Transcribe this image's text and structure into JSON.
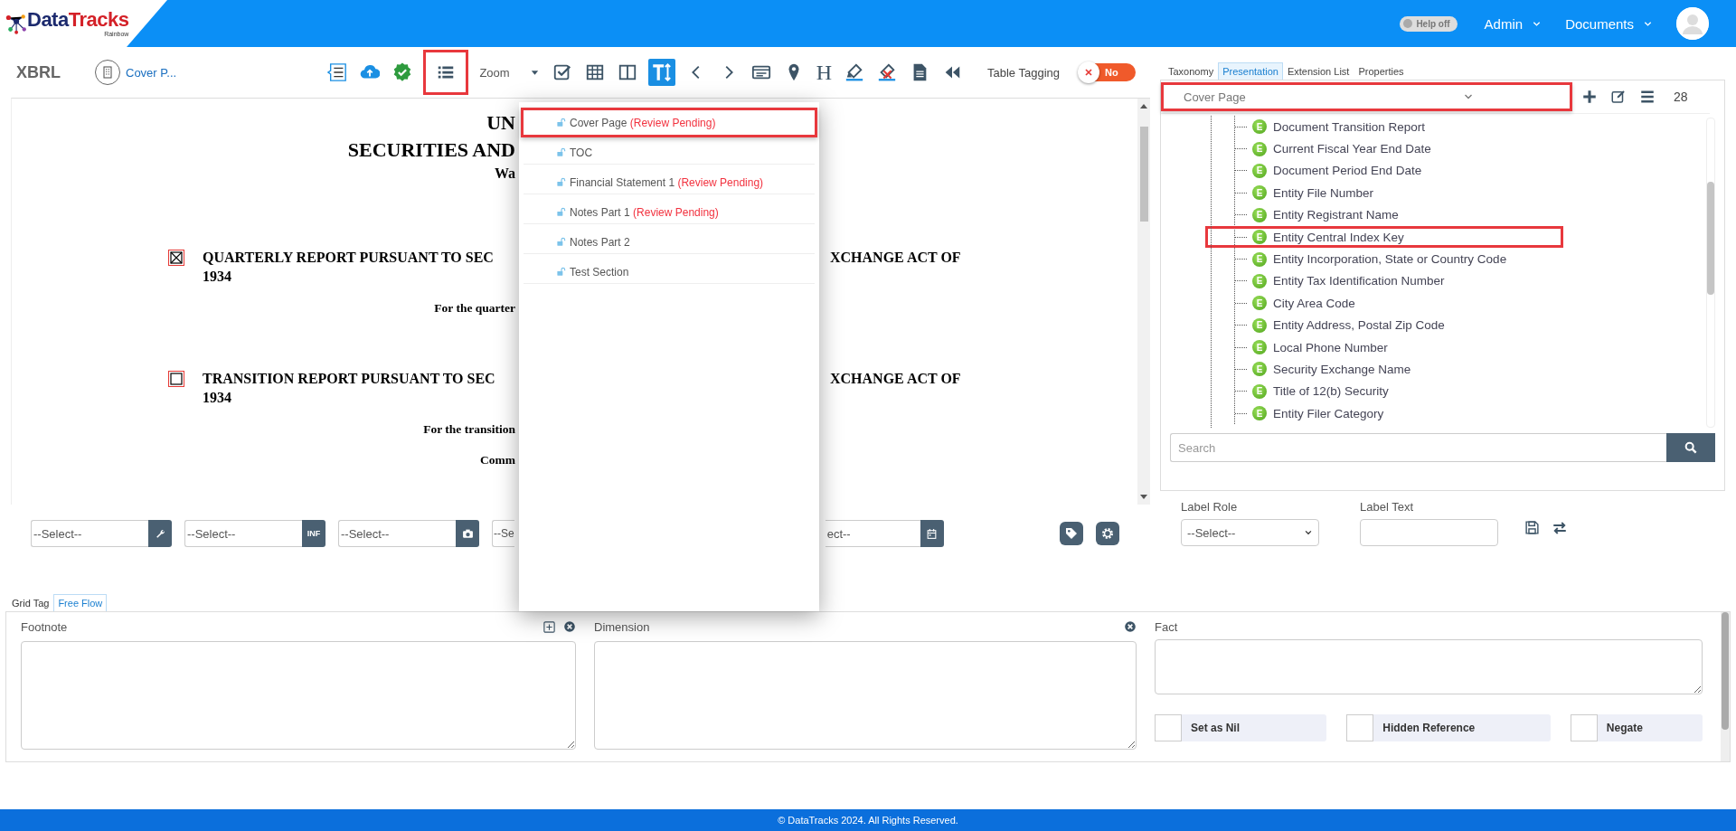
{
  "header": {
    "logo": {
      "brand_a": "Data",
      "brand_b": "Tracks",
      "tagline": "Rainbow"
    },
    "help_toggle": {
      "label": "Help off",
      "on": false
    },
    "menus": [
      {
        "label": "Admin"
      },
      {
        "label": "Documents"
      }
    ]
  },
  "toolbar": {
    "title": "XBRL",
    "section": "Cover P...",
    "tools_before": [
      {
        "kind": "outline"
      },
      {
        "kind": "upload"
      },
      {
        "kind": "verified"
      }
    ],
    "sections_button": {
      "highlighted": true
    },
    "zoom": {
      "label": "Zoom"
    },
    "tools_middle": [
      {
        "kind": "check"
      },
      {
        "kind": "table"
      },
      {
        "kind": "columns"
      }
    ],
    "text_height_button": {
      "active": true
    },
    "tools_after": [
      {
        "kind": "prev"
      },
      {
        "kind": "next"
      },
      {
        "kind": "card"
      },
      {
        "kind": "pin"
      },
      {
        "kind": "heading",
        "label": "H"
      },
      {
        "kind": "highlighter"
      },
      {
        "kind": "clear-highlight"
      },
      {
        "kind": "document"
      },
      {
        "kind": "rewind"
      }
    ],
    "table_tagging": {
      "label": "Table Tagging",
      "on": false,
      "state_label": "No"
    }
  },
  "document": {
    "lines": [
      {
        "kind": "title",
        "left": "UN"
      },
      {
        "kind": "title",
        "left": "SECURITIES AND"
      },
      {
        "kind": "subtitle",
        "left": "Wa"
      },
      {
        "kind": "report",
        "checked": true,
        "left": "QUARTERLY REPORT PURSUANT TO SEC",
        "right": "XCHANGE ACT OF",
        "second": "1934"
      },
      {
        "kind": "note",
        "left": "For the quarter"
      },
      {
        "kind": "report",
        "checked": false,
        "left": "TRANSITION REPORT PURSUANT TO SEC",
        "right": "XCHANGE ACT OF",
        "second": "1934"
      },
      {
        "kind": "note",
        "left": "For the transition"
      },
      {
        "kind": "note",
        "left": "Comm"
      }
    ]
  },
  "section_menu": {
    "items": [
      {
        "name": "Cover Page",
        "status": "(Review Pending)",
        "highlighted": true
      },
      {
        "name": "TOC",
        "highlighted": false
      },
      {
        "name": "Financial Statement 1",
        "status": "(Review Pending)",
        "highlighted": false
      },
      {
        "name": "Notes Part 1",
        "status": "(Review Pending)",
        "highlighted": false
      },
      {
        "name": "Notes Part 2",
        "highlighted": false
      },
      {
        "name": "Test Section",
        "highlighted": false
      }
    ]
  },
  "tag_fields": [
    {
      "kind": "wrench",
      "value": "--Select--"
    },
    {
      "kind": "inf",
      "value": "--Select--",
      "button_label": "INF"
    },
    {
      "kind": "image",
      "value": "--Select--"
    },
    {
      "kind": "covered",
      "value": "--Se"
    },
    {
      "kind": "calendar",
      "value": "ect--"
    }
  ],
  "tag_actions": [
    {
      "kind": "tag"
    },
    {
      "kind": "gear"
    }
  ],
  "right_panel": {
    "tabs": [
      {
        "label": "Taxonomy",
        "selected": false
      },
      {
        "label": "Presentation",
        "selected": true
      },
      {
        "label": "Extension List",
        "selected": false
      },
      {
        "label": "Properties",
        "selected": false
      }
    ],
    "section_select": {
      "value": "Cover Page",
      "highlighted": true
    },
    "count": "28",
    "tree": {
      "items": [
        {
          "badge": "E",
          "label": "Document Transition Report",
          "highlighted": false
        },
        {
          "badge": "E",
          "label": "Current Fiscal Year End Date",
          "highlighted": false
        },
        {
          "badge": "E",
          "label": "Document Period End Date",
          "highlighted": false
        },
        {
          "badge": "E",
          "label": "Entity File Number",
          "highlighted": false
        },
        {
          "badge": "E",
          "label": "Entity Registrant Name",
          "highlighted": false
        },
        {
          "badge": "E",
          "label": "Entity Central Index Key",
          "highlighted": true
        },
        {
          "badge": "E",
          "label": "Entity Incorporation, State or Country Code",
          "highlighted": false
        },
        {
          "badge": "E",
          "label": "Entity Tax Identification Number",
          "highlighted": false
        },
        {
          "badge": "E",
          "label": "City Area Code",
          "highlighted": false
        },
        {
          "badge": "E",
          "label": "Entity Address, Postal Zip Code",
          "highlighted": false
        },
        {
          "badge": "E",
          "label": "Local Phone Number",
          "highlighted": false
        },
        {
          "badge": "E",
          "label": "Security Exchange Name",
          "highlighted": false
        },
        {
          "badge": "E",
          "label": "Title of 12(b) Security",
          "highlighted": false
        },
        {
          "badge": "E",
          "label": "Entity Filer Category",
          "highlighted": false
        }
      ]
    },
    "search": {
      "placeholder": "Search"
    }
  },
  "label_editor": {
    "role": {
      "label": "Label Role",
      "value": "--Select--"
    },
    "text": {
      "label": "Label Text"
    }
  },
  "bottom_tabs": [
    {
      "label": "Grid Tag",
      "selected": false
    },
    {
      "label": "Free Flow",
      "selected": true
    }
  ],
  "footnote": {
    "label": "Footnote"
  },
  "dimension": {
    "label": "Dimension"
  },
  "fact": {
    "label": "Fact"
  },
  "fact_options": [
    {
      "label": "Set as Nil",
      "checked": false
    },
    {
      "label": "Hidden Reference",
      "checked": false
    },
    {
      "label": "Negate",
      "checked": false
    }
  ],
  "footer": "© DataTracks 2024. All Rights Reserved."
}
